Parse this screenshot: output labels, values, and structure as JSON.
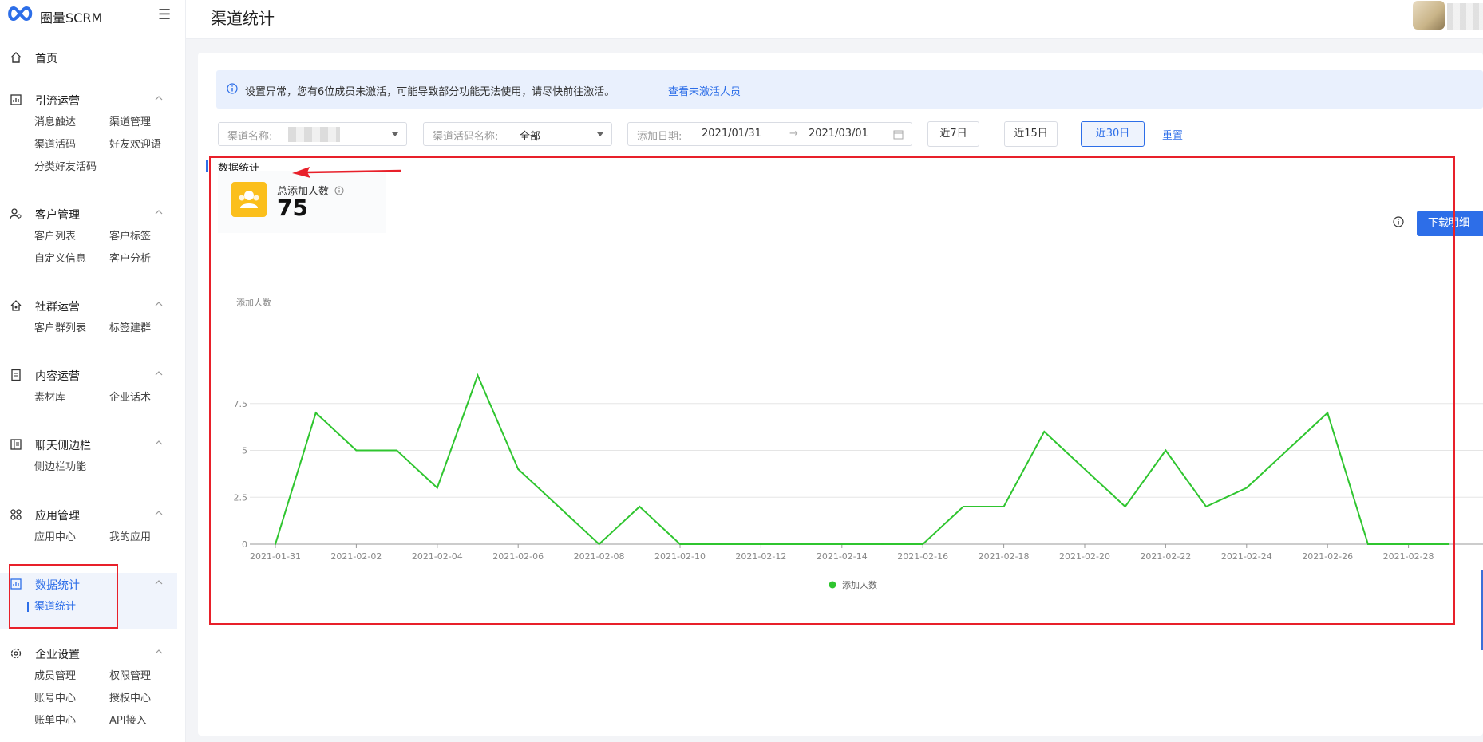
{
  "app": {
    "name": "圈量SCRM"
  },
  "header": {
    "title": "渠道统计"
  },
  "sidebar": {
    "home": "首页",
    "groups": [
      {
        "label": "引流运营",
        "items": [
          "消息触达",
          "渠道管理",
          "渠道活码",
          "好友欢迎语",
          "分类好友活码"
        ]
      },
      {
        "label": "客户管理",
        "items": [
          "客户列表",
          "客户标签",
          "自定义信息",
          "客户分析"
        ]
      },
      {
        "label": "社群运营",
        "items": [
          "客户群列表",
          "标签建群"
        ]
      },
      {
        "label": "内容运营",
        "items": [
          "素材库",
          "企业话术"
        ]
      },
      {
        "label": "聊天侧边栏",
        "items": [
          "侧边栏功能"
        ]
      },
      {
        "label": "应用管理",
        "items": [
          "应用中心",
          "我的应用"
        ]
      },
      {
        "label": "数据统计",
        "items": [
          "渠道统计"
        ]
      },
      {
        "label": "企业设置",
        "items": [
          "成员管理",
          "权限管理",
          "账号中心",
          "授权中心",
          "账单中心",
          "API接入"
        ]
      }
    ],
    "active_group": "数据统计",
    "active_item": "渠道统计"
  },
  "alert": {
    "message": "设置异常，您有6位成员未激活，可能导致部分功能无法使用，请尽快前往激活。",
    "link": "查看未激活人员"
  },
  "filters": {
    "channel_name_label": "渠道名称:",
    "channel_code_label": "渠道活码名称:",
    "channel_code_value": "全部",
    "date_label": "添加日期:",
    "date_start": "2021/01/31",
    "date_arrow": "→",
    "date_end": "2021/03/01",
    "quick": [
      "近7日",
      "近15日",
      "近30日"
    ],
    "quick_selected": "近30日",
    "reset": "重置"
  },
  "section": {
    "title": "数据统计"
  },
  "stat": {
    "label": "总添加人数",
    "value": "75"
  },
  "download_button": "下载明细",
  "colors": {
    "accent": "#2d6ee8",
    "line": "#2fc52f",
    "highlight": "#e8202a",
    "stat_icon": "#fbbf1c"
  },
  "chart_data": {
    "type": "line",
    "ylabel": "添加人数",
    "ylim": [
      0,
      10
    ],
    "yticks": [
      "0",
      "2.5",
      "5",
      "7.5"
    ],
    "x": [
      "2021-01-31",
      "2021-02-01",
      "2021-02-02",
      "2021-02-03",
      "2021-02-04",
      "2021-02-05",
      "2021-02-06",
      "2021-02-07",
      "2021-02-08",
      "2021-02-09",
      "2021-02-10",
      "2021-02-11",
      "2021-02-12",
      "2021-02-13",
      "2021-02-14",
      "2021-02-15",
      "2021-02-16",
      "2021-02-17",
      "2021-02-18",
      "2021-02-19",
      "2021-02-20",
      "2021-02-21",
      "2021-02-22",
      "2021-02-23",
      "2021-02-24",
      "2021-02-25",
      "2021-02-26",
      "2021-02-27",
      "2021-02-28",
      "2021-03-01"
    ],
    "xticks": [
      "2021-01-31",
      "2021-02-02",
      "2021-02-04",
      "2021-02-06",
      "2021-02-08",
      "2021-02-10",
      "2021-02-12",
      "2021-02-14",
      "2021-02-16",
      "2021-02-18",
      "2021-02-20",
      "2021-02-22",
      "2021-02-24",
      "2021-02-26",
      "2021-02-28"
    ],
    "series": [
      {
        "name": "添加人数",
        "values": [
          0,
          7,
          5,
          5,
          3,
          9,
          4,
          2,
          0,
          2,
          0,
          0,
          0,
          0,
          0,
          0,
          0,
          2,
          2,
          6,
          4,
          2,
          5,
          2,
          3,
          5,
          7,
          0,
          0,
          0
        ]
      }
    ],
    "grid": true,
    "legend": "bottom-center"
  }
}
